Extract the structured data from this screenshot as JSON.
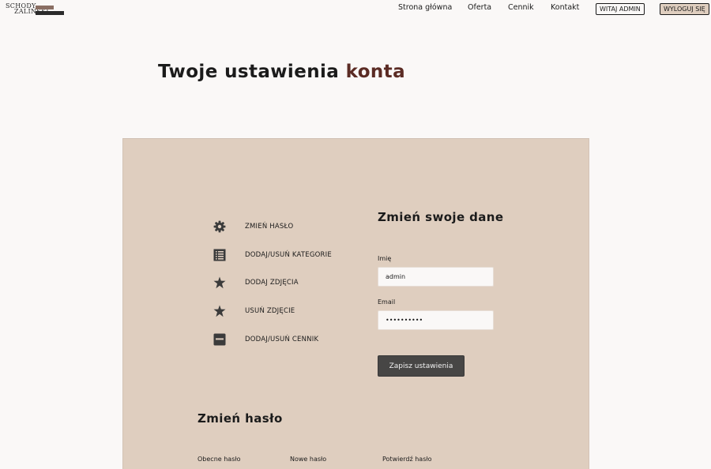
{
  "header": {
    "logo_line1": "SCHODY",
    "logo_line2": "ZALIŃSKI",
    "nav": [
      "Strona główna",
      "Oferta",
      "Cennik",
      "Kontakt"
    ],
    "welcome_button": "WITAJ ADMIN",
    "logout_button": "WYLOGUJ SIĘ"
  },
  "page": {
    "title_main": "Twoje ustawienia",
    "title_accent": "konta"
  },
  "sidebar": {
    "items": [
      {
        "label": "ZMIEŃ HASŁO",
        "icon": "gear-icon"
      },
      {
        "label": "DODAJ/USUŃ KATEGORIE",
        "icon": "list-icon"
      },
      {
        "label": "DODAJ ZDJĘCIA",
        "icon": "star-icon"
      },
      {
        "label": "USUŃ ZDJĘCIE",
        "icon": "star-icon"
      },
      {
        "label": "DODAJ/USUŃ CENNIK",
        "icon": "card-icon"
      }
    ]
  },
  "form": {
    "title": "Zmień swoje dane",
    "name_label": "Imię",
    "name_value": "admin",
    "email_label": "Email",
    "email_value": "••••••••••",
    "save_button": "Zapisz ustawienia"
  },
  "password": {
    "title": "Zmień hasło",
    "labels": [
      "Obecne hasło",
      "Nowe hasło",
      "Potwierdź hasło"
    ]
  },
  "colors": {
    "accent": "#5b2b24",
    "panel": "#dfcebf",
    "button": "#474645",
    "background": "#faf8f7"
  }
}
